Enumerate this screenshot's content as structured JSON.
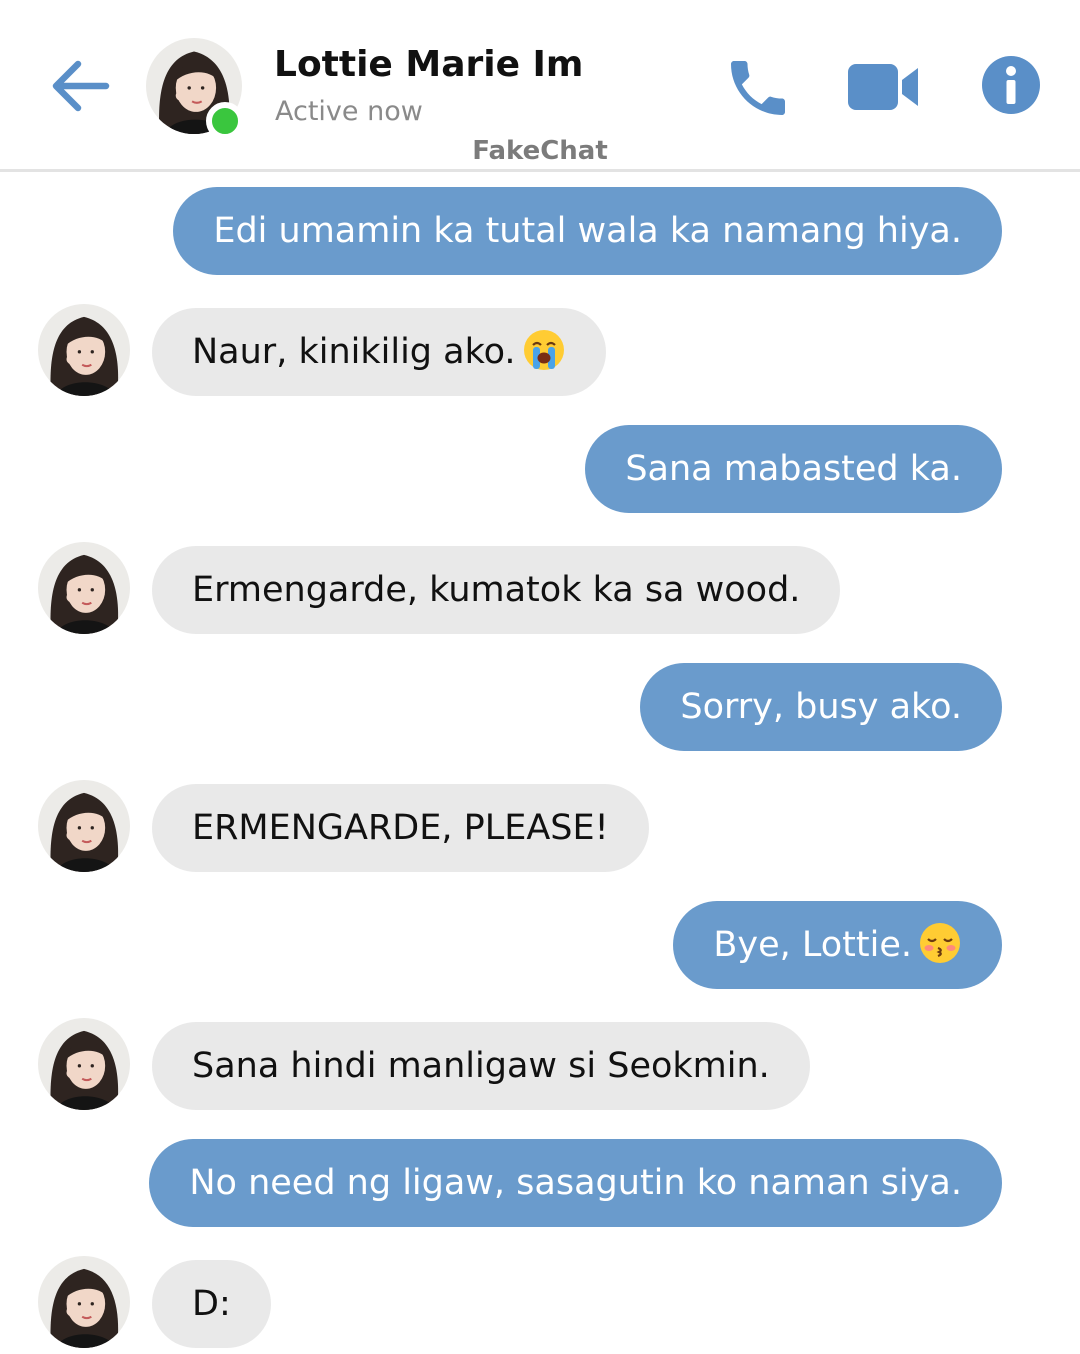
{
  "header": {
    "contact_name": "Lottie Marie Im",
    "status": "Active now",
    "watermark": "FakeChat",
    "icons": {
      "back": "arrow-left-icon",
      "call": "phone-icon",
      "video": "video-camera-icon",
      "info": "info-icon"
    }
  },
  "colors": {
    "accent": "#6a9bcc",
    "outgoing_bubble": "#6a9bcc",
    "incoming_bubble": "#e9e9e9",
    "online": "#3ac63e"
  },
  "messages": [
    {
      "sender": "me",
      "text": "Edi umamin ka tutal wala ka namang hiya."
    },
    {
      "sender": "contact",
      "text": "Naur, kinikilig ako.",
      "emoji": "loudly-crying-face-emoji"
    },
    {
      "sender": "me",
      "text": "Sana mabasted ka."
    },
    {
      "sender": "contact",
      "text": "Ermengarde, kumatok ka sa wood."
    },
    {
      "sender": "me",
      "text": "Sorry, busy ako."
    },
    {
      "sender": "contact",
      "text": "ERMENGARDE, PLEASE!"
    },
    {
      "sender": "me",
      "text": "Bye, Lottie.",
      "emoji": "kissing-face-closed-eyes-emoji"
    },
    {
      "sender": "contact",
      "text": "Sana hindi manligaw si Seokmin."
    },
    {
      "sender": "me",
      "text": "No need ng ligaw, sasagutin ko naman siya."
    },
    {
      "sender": "contact",
      "text": "D:"
    }
  ]
}
